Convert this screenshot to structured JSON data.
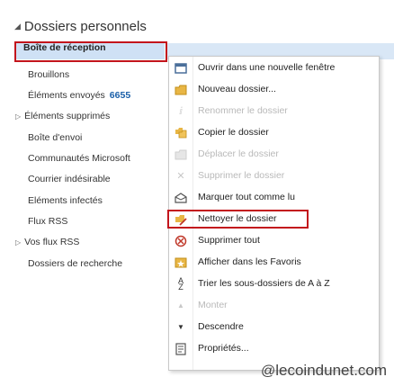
{
  "section": {
    "title": "Dossiers personnels"
  },
  "folders": [
    {
      "label": "Boîte de réception"
    },
    {
      "label": "Brouillons"
    },
    {
      "label": "Éléments envoyés",
      "count": "6655"
    },
    {
      "label": "Éléments supprimés"
    },
    {
      "label": "Boîte d'envoi"
    },
    {
      "label": "Communautés Microsoft"
    },
    {
      "label": "Courrier indésirable"
    },
    {
      "label": "Eléments infectés"
    },
    {
      "label": "Flux RSS"
    },
    {
      "label": "Vos flux RSS"
    },
    {
      "label": "Dossiers de recherche"
    }
  ],
  "menu": [
    {
      "label": "Ouvrir dans une nouvelle fenêtre",
      "icon": "open-window-icon",
      "enabled": true
    },
    {
      "label": "Nouveau dossier...",
      "icon": "new-folder-icon",
      "enabled": true
    },
    {
      "label": "Renommer le dossier",
      "icon": "rename-icon",
      "enabled": false
    },
    {
      "label": "Copier le dossier",
      "icon": "copy-folder-icon",
      "enabled": true
    },
    {
      "label": "Déplacer le dossier",
      "icon": "move-folder-icon",
      "enabled": false
    },
    {
      "label": "Supprimer le dossier",
      "icon": "delete-folder-icon",
      "enabled": false
    },
    {
      "label": "Marquer tout comme lu",
      "icon": "mark-read-icon",
      "enabled": true
    },
    {
      "label": "Nettoyer le dossier",
      "icon": "clean-folder-icon",
      "enabled": true
    },
    {
      "label": "Supprimer tout",
      "icon": "delete-all-icon",
      "enabled": true
    },
    {
      "label": "Afficher dans les Favoris",
      "icon": "favorites-icon",
      "enabled": true
    },
    {
      "label": "Trier les sous-dossiers de A à Z",
      "icon": "sort-az-icon",
      "enabled": true
    },
    {
      "label": "Monter",
      "icon": "move-up-icon",
      "enabled": false
    },
    {
      "label": "Descendre",
      "icon": "move-down-icon",
      "enabled": true
    },
    {
      "label": "Propriétés...",
      "icon": "properties-icon",
      "enabled": true
    }
  ],
  "watermark": {
    "at": "@",
    "text": "lecoindunet.com"
  },
  "colors": {
    "accent": "#c3151c",
    "selection": "#cfe1f5",
    "count": "#1a5fa8"
  }
}
